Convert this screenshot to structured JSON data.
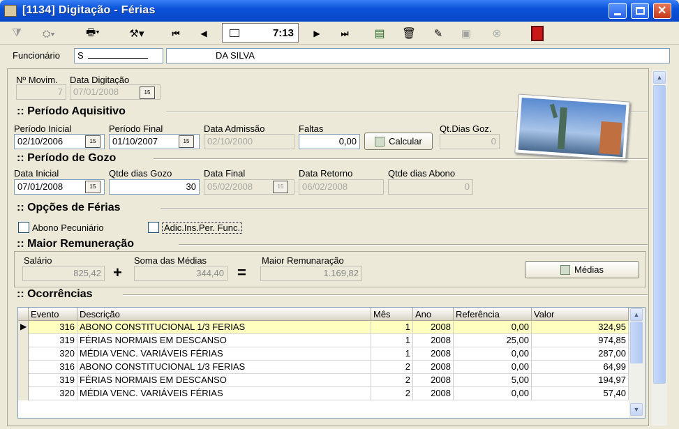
{
  "window": {
    "title": "[1134] Digitação - Férias"
  },
  "toolbar": {
    "time": "7:13"
  },
  "funcionario": {
    "label": "Funcionário",
    "code": "S",
    "name": "DA SILVA"
  },
  "header_fields": {
    "movim_label": "Nº Movim.",
    "movim_value": "7",
    "data_dig_label": "Data Digitação",
    "data_dig_value": "07/01/2008"
  },
  "aquisitivo": {
    "section": ":: Período Aquisitivo",
    "inicial_label": "Período Inicial",
    "inicial_value": "02/10/2006",
    "final_label": "Período Final",
    "final_value": "01/10/2007",
    "admissao_label": "Data Admissão",
    "admissao_value": "02/10/2000",
    "faltas_label": "Faltas",
    "faltas_value": "0,00",
    "calcular_label": "Calcular",
    "qtdias_label": "Qt.Dias Goz.",
    "qtdias_value": "0"
  },
  "gozo": {
    "section": ":: Período de Gozo",
    "inicial_label": "Data Inicial",
    "inicial_value": "07/01/2008",
    "qtde_label": "Qtde dias Gozo",
    "qtde_value": "30",
    "final_label": "Data Final",
    "final_value": "05/02/2008",
    "retorno_label": "Data Retorno",
    "retorno_value": "06/02/2008",
    "abono_label": "Qtde dias Abono",
    "abono_value": "0"
  },
  "opcoes": {
    "section": ":: Opções de Férias",
    "abono_label": "Abono Pecuniário",
    "adic_label": "Adic.Ins.Per. Func."
  },
  "remuneracao": {
    "section": ":: Maior Remuneração",
    "salario_label": "Salário",
    "salario_value": "825,42",
    "plus": "+",
    "soma_label": "Soma das Médias",
    "soma_value": "344,40",
    "equals": "=",
    "maior_label": "Maior Remunaração",
    "maior_value": "1.169,82",
    "medias_label": "Médias"
  },
  "ocorrencias": {
    "section": ":: Ocorrências",
    "columns": [
      "Evento",
      "Descrição",
      "Mês",
      "Ano",
      "Referência",
      "Valor"
    ],
    "rows": [
      [
        "316",
        "ABONO CONSTITUCIONAL 1/3 FERIAS",
        "1",
        "2008",
        "0,00",
        "324,95"
      ],
      [
        "319",
        "FÉRIAS NORMAIS EM DESCANSO",
        "1",
        "2008",
        "25,00",
        "974,85"
      ],
      [
        "320",
        "MÉDIA VENC. VARIÁVEIS FÉRIAS",
        "1",
        "2008",
        "0,00",
        "287,00"
      ],
      [
        "316",
        "ABONO CONSTITUCIONAL 1/3 FERIAS",
        "2",
        "2008",
        "0,00",
        "64,99"
      ],
      [
        "319",
        "FÉRIAS NORMAIS EM DESCANSO",
        "2",
        "2008",
        "5,00",
        "194,97"
      ],
      [
        "320",
        "MÉDIA VENC. VARIÁVEIS FÉRIAS",
        "2",
        "2008",
        "0,00",
        "57,40"
      ]
    ]
  }
}
